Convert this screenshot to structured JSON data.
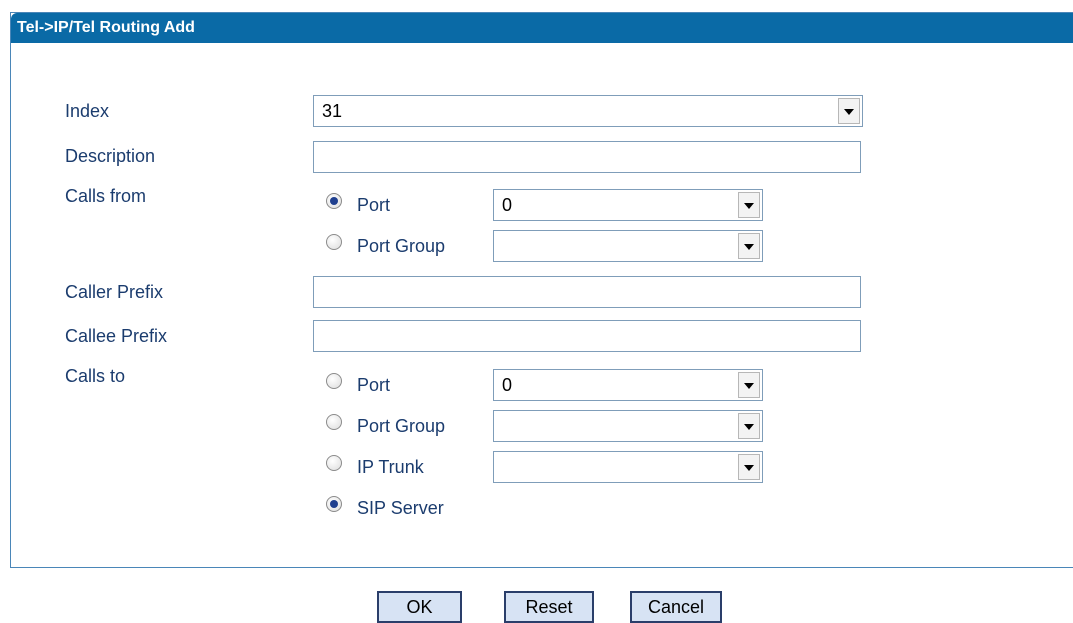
{
  "panel": {
    "title": "Tel->IP/Tel Routing Add"
  },
  "form": {
    "index": {
      "label": "Index",
      "value": "31"
    },
    "description": {
      "label": "Description",
      "value": ""
    },
    "calls_from": {
      "label": "Calls from",
      "port": {
        "label": "Port",
        "value": "0",
        "selected": true
      },
      "port_group": {
        "label": "Port Group",
        "value": "",
        "selected": false
      }
    },
    "caller_prefix": {
      "label": "Caller Prefix",
      "value": ""
    },
    "callee_prefix": {
      "label": "Callee Prefix",
      "value": ""
    },
    "calls_to": {
      "label": "Calls to",
      "port": {
        "label": "Port",
        "value": "0",
        "selected": false
      },
      "port_group": {
        "label": "Port Group",
        "value": "",
        "selected": false
      },
      "ip_trunk": {
        "label": "IP Trunk",
        "value": "",
        "selected": false
      },
      "sip_server": {
        "label": "SIP Server",
        "selected": true
      }
    }
  },
  "buttons": {
    "ok": "OK",
    "reset": "Reset",
    "cancel": "Cancel"
  }
}
